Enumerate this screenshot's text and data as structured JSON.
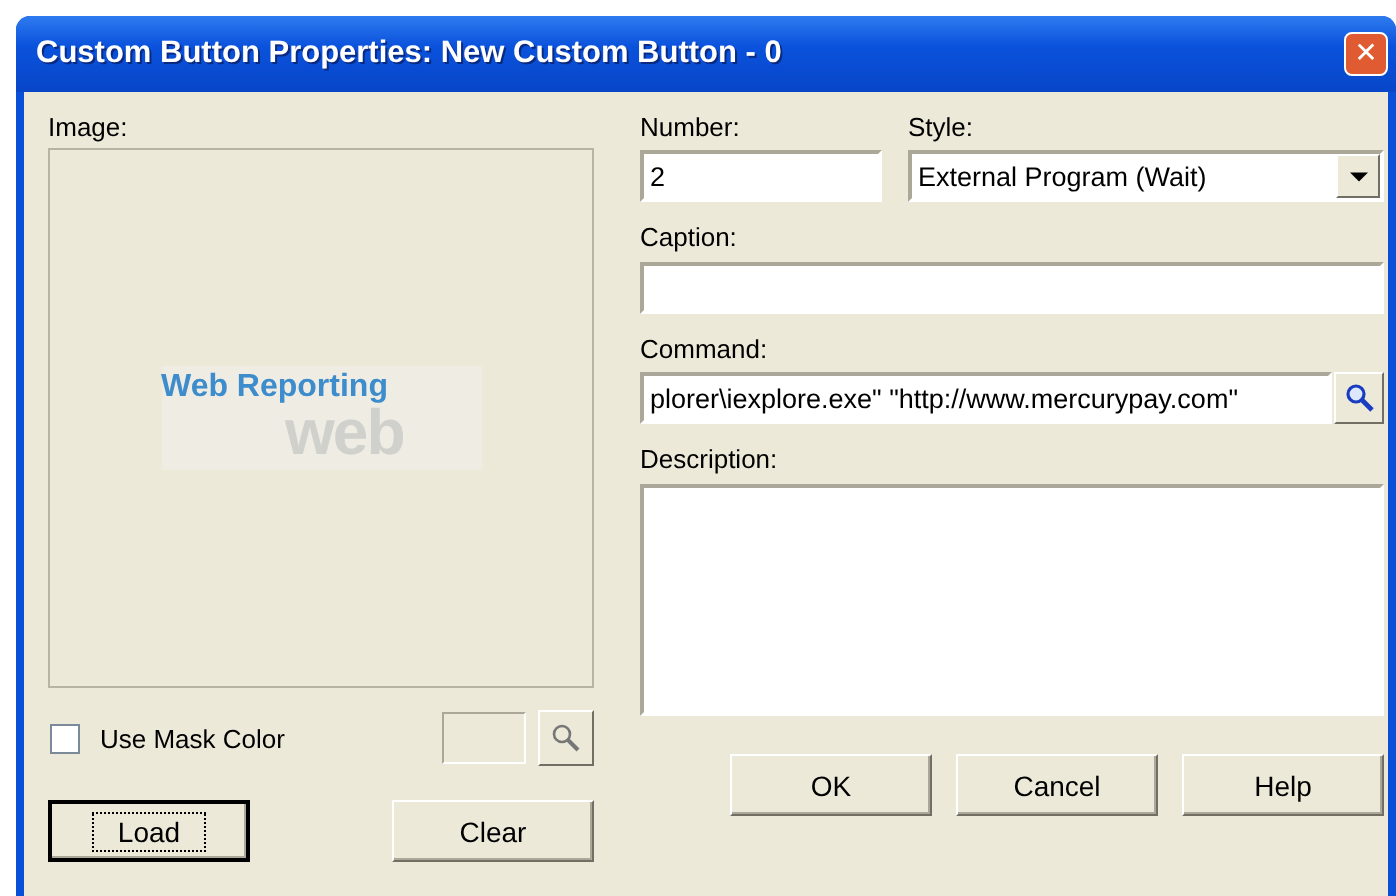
{
  "window": {
    "title": "Custom Button Properties: New Custom Button - 0",
    "close": "✕"
  },
  "image": {
    "label": "Image:",
    "preview": {
      "kind": "logo",
      "caption": "Web Reporting",
      "mark": "web"
    }
  },
  "mask": {
    "label": "Use Mask Color",
    "checked": false
  },
  "left_buttons": [
    {
      "label": "Load",
      "default": true
    },
    {
      "label": "Clear",
      "default": false
    }
  ],
  "number": {
    "label": "Number:",
    "value": "2"
  },
  "style": {
    "label": "Style:",
    "value": "External Program (Wait)"
  },
  "caption": {
    "label": "Caption:"
  },
  "command": {
    "label": "Command:",
    "value": "plorer\\iexplore.exe\" \"http://www.mercurypay.com\""
  },
  "description": {
    "label": "Description:"
  },
  "buttons": [
    {
      "label": "OK"
    },
    {
      "label": "Cancel"
    },
    {
      "label": "Help"
    }
  ]
}
